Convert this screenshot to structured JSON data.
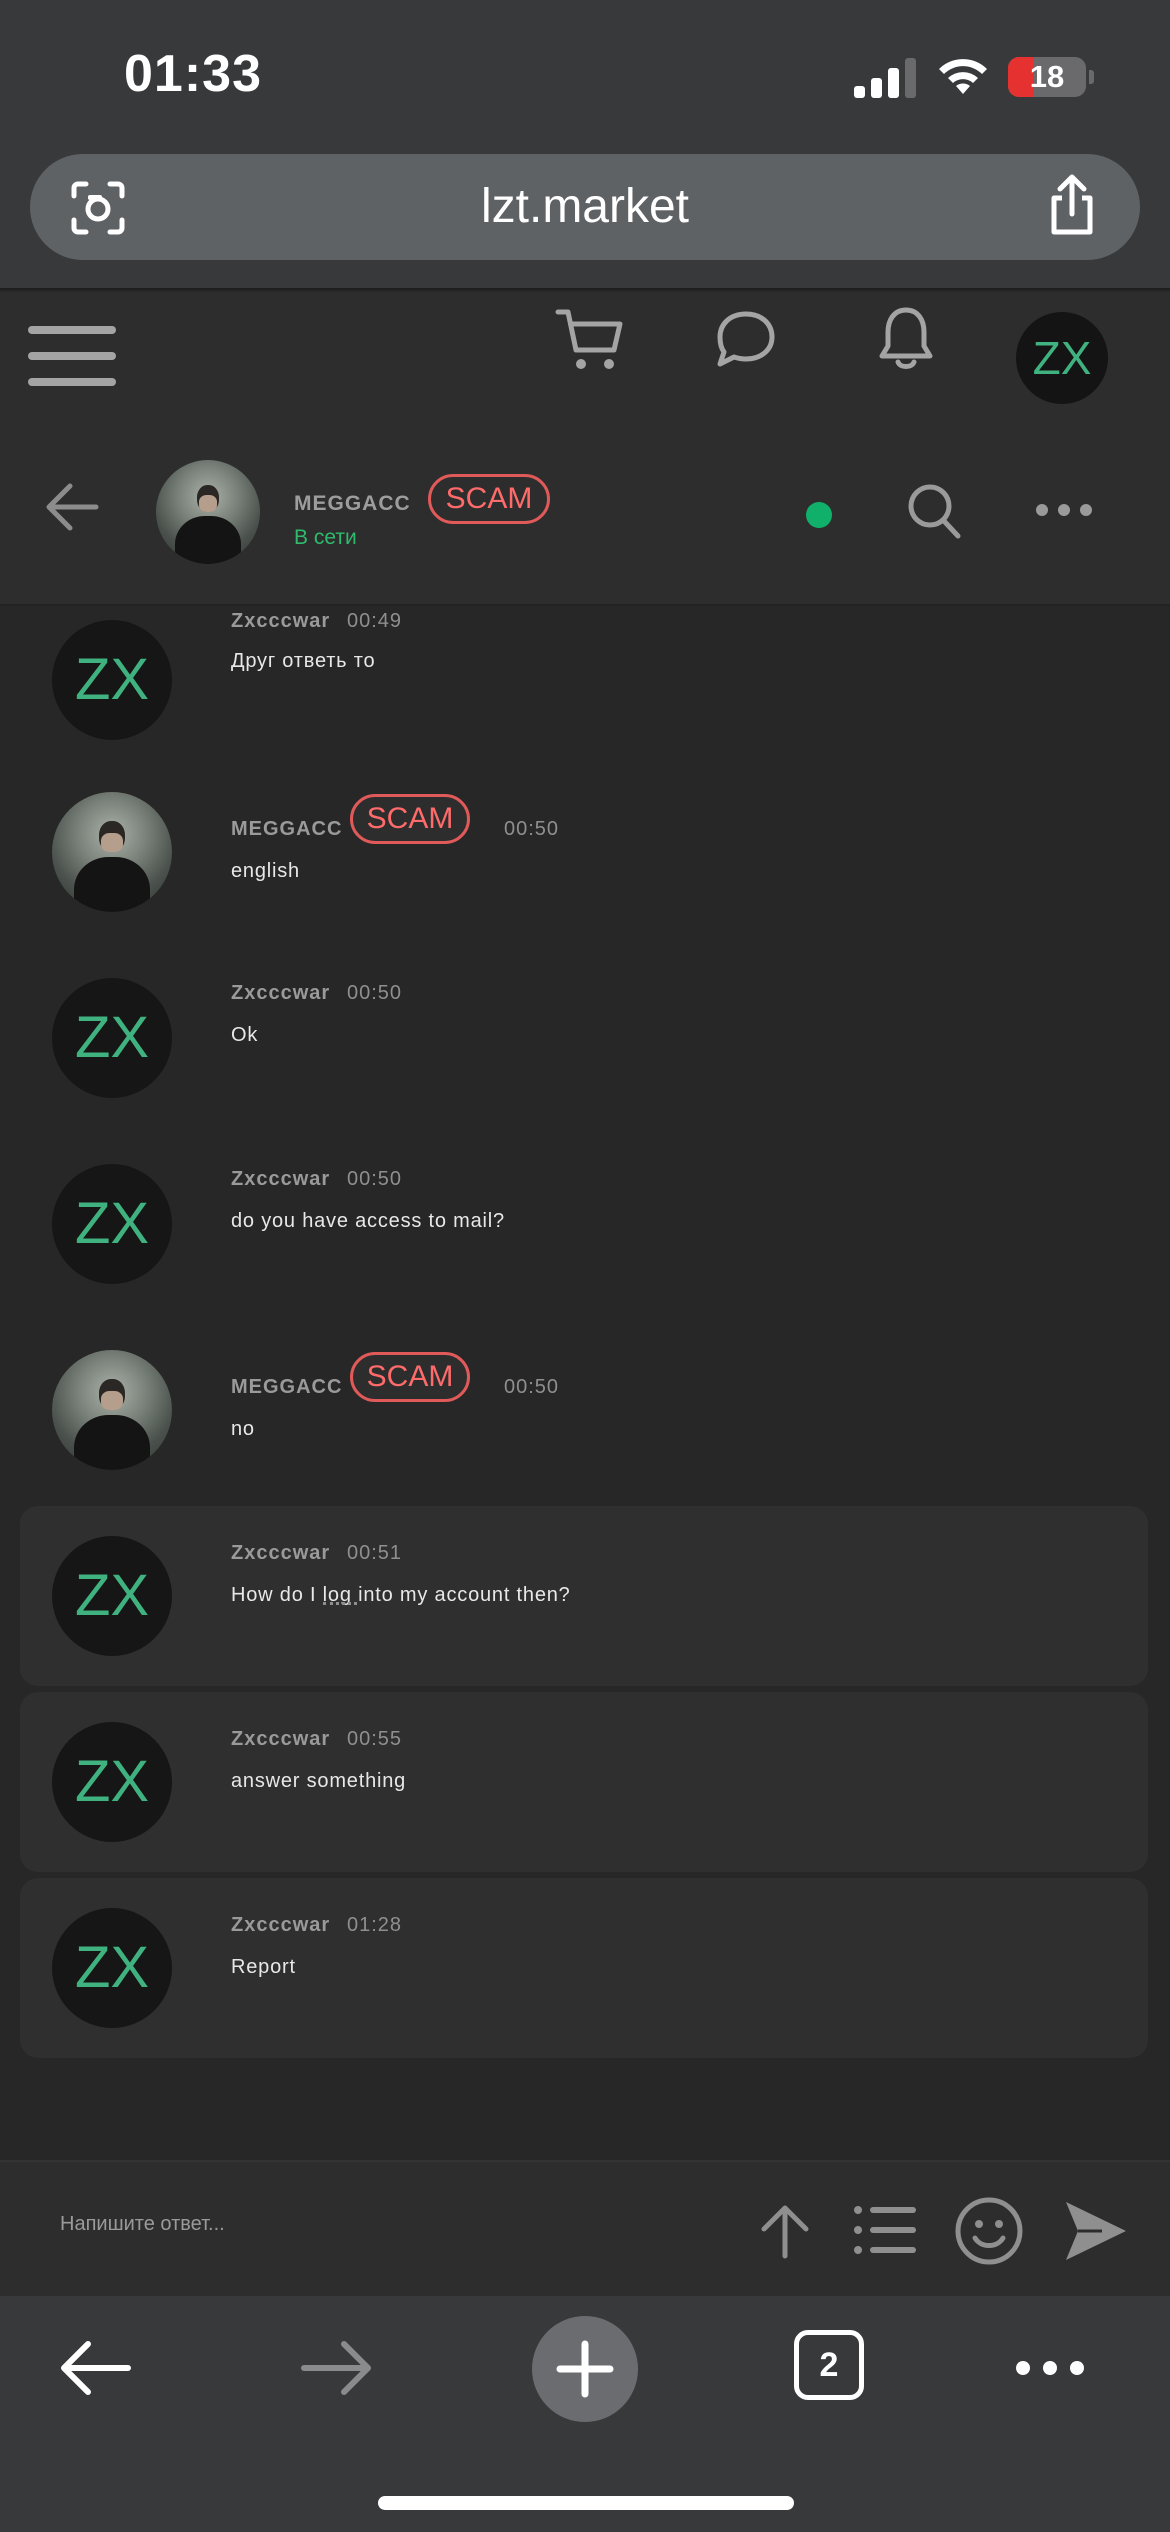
{
  "status_bar": {
    "time": "01:33",
    "battery": "18",
    "icons": [
      "signal-icon",
      "wifi-icon",
      "battery-icon"
    ]
  },
  "browser": {
    "url": "lzt.market",
    "icons": [
      "lens-icon",
      "share-icon"
    ]
  },
  "site_header": {
    "icons": [
      "menu-icon",
      "cart-icon",
      "chat-icon",
      "bell-icon"
    ],
    "user_avatar_initials": "ZX"
  },
  "chat_header": {
    "peer_name": "MEGGACC",
    "peer_badge": "SCAM",
    "peer_status": "В сети",
    "icons": [
      "back-arrow-icon",
      "online-dot-icon",
      "search-icon",
      "more-icon"
    ]
  },
  "messages": [
    {
      "author": "Zxcccwar",
      "time": "00:49",
      "text": "Друг ответь то",
      "avatar": "ZX"
    },
    {
      "author": "MEGGACC",
      "badge": "SCAM",
      "time": "00:50",
      "text": "english"
    },
    {
      "author": "Zxcccwar",
      "time": "00:50",
      "text": "Ok",
      "avatar": "ZX"
    },
    {
      "author": "Zxcccwar",
      "time": "00:50",
      "text": "do you have access to mail?",
      "avatar": "ZX"
    },
    {
      "author": "MEGGACC",
      "badge": "SCAM",
      "time": "00:50",
      "text": "no"
    },
    {
      "author": "Zxcccwar",
      "time": "00:51",
      "text": "How do I log into my account then?",
      "avatar": "ZX"
    },
    {
      "author": "Zxcccwar",
      "time": "00:55",
      "text": "answer something",
      "avatar": "ZX"
    },
    {
      "author": "Zxcccwar",
      "time": "01:28",
      "text": "Report",
      "avatar": "ZX"
    }
  ],
  "composer": {
    "placeholder": "Напишите ответ...",
    "icons": [
      "up-arrow-icon",
      "list-icon",
      "emoji-icon",
      "send-icon"
    ]
  },
  "toolbar": {
    "tab_count": "2",
    "icons": [
      "back-icon",
      "forward-icon",
      "plus-icon",
      "tabs-icon",
      "more-icon"
    ]
  },
  "colors": {
    "background": "#272727",
    "accent_green": "#3fb27f",
    "online_green": "#10b06a",
    "scam_red": "#e05a5a"
  }
}
